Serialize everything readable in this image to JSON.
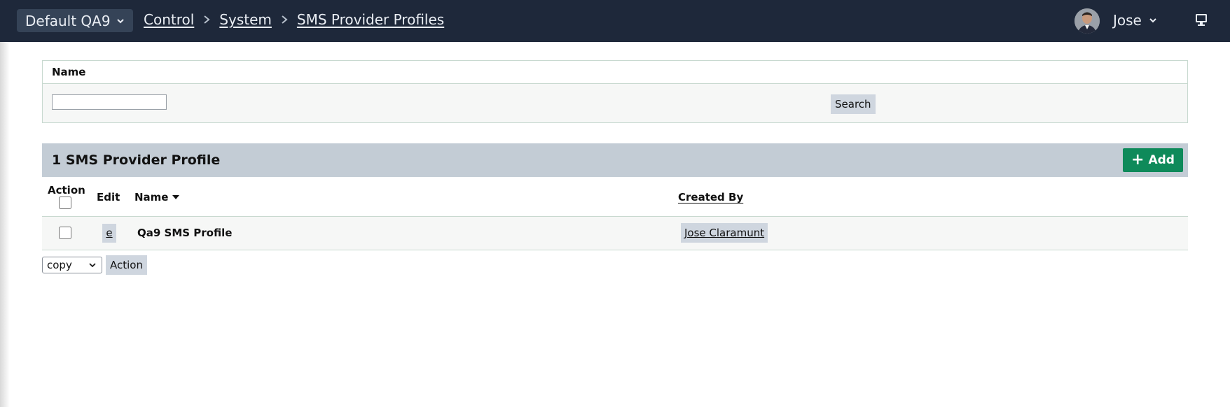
{
  "topbar": {
    "tenant": "Default QA9",
    "breadcrumbs": [
      "Control",
      "System",
      "SMS Provider Profiles"
    ],
    "user_name": "Jose"
  },
  "filter": {
    "name_label": "Name",
    "name_value": "",
    "search_label": "Search"
  },
  "results": {
    "title": "1 SMS Provider Profile",
    "add_label": "Add",
    "columns": {
      "action": "Action",
      "edit": "Edit",
      "name": "Name",
      "created_by": "Created By"
    },
    "rows": [
      {
        "edit_link": "e",
        "name": "Qa9 SMS Profile",
        "created_by": "Jose Claramunt"
      }
    ]
  },
  "bulk": {
    "selected_option": "copy",
    "action_label": "Action"
  },
  "colors": {
    "topbar": "#1e283a",
    "accent_green": "#0e8a5a",
    "header_band": "#c3ccd5"
  }
}
